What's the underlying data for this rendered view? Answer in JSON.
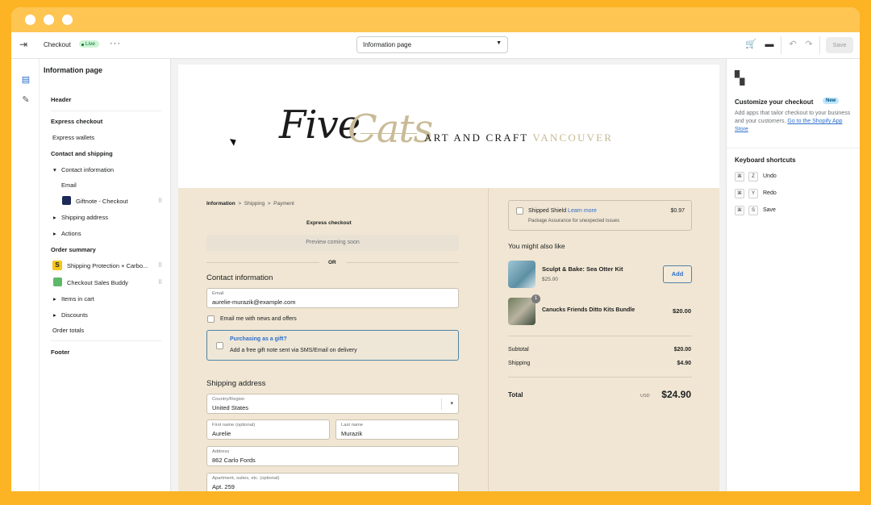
{
  "topbar": {
    "title": "Checkout",
    "badge": "Live",
    "more": "···",
    "page_select": "Information page",
    "save": "Save"
  },
  "sidebar": {
    "title": "Information page",
    "header": "Header",
    "express_checkout": "Express checkout",
    "express_wallets": "Express wallets",
    "contact_shipping": "Contact and shipping",
    "contact_information": "Contact information",
    "email": "Email",
    "giftnote": "Giftnote - Checkout",
    "shipping_address": "Shipping address",
    "actions": "Actions",
    "order_summary": "Order summary",
    "shipping_protection": "Shipping Protection + Carbo...",
    "checkout_sales_buddy": "Checkout Sales Buddy",
    "items_in_cart": "Items in cart",
    "discounts": "Discounts",
    "order_totals": "Order totals",
    "footer": "Footer"
  },
  "logo": {
    "five": "Five",
    "cats": "Cats",
    "sub1": "ART AND CRAFT",
    "sub2": "VANCOUVER"
  },
  "checkout": {
    "crumb_information": "Information",
    "crumb_shipping": "Shipping",
    "crumb_payment": "Payment",
    "express_checkout": "Express checkout",
    "preview": "Preview coming soon",
    "or": "OR",
    "contact_title": "Contact information",
    "email_label": "Email",
    "email_value": "aurelie-murazik@example.com",
    "news_label": "Email me with news and offers",
    "gift_title": "Purchasing as a gift?",
    "gift_sub": "Add a free gift note sent via SMS/Email on delivery",
    "shipping_title": "Shipping address",
    "country_label": "Country/Region",
    "country_value": "United States",
    "first_label": "First name (optional)",
    "first_value": "Aurelie",
    "last_label": "Last name",
    "last_value": "Murazik",
    "address_label": "Address",
    "address_value": "862 Carlo Fords",
    "apt_label": "Apartment, suites, etc. (optional)",
    "apt_value": "Apt. 259"
  },
  "summary": {
    "shield_title": "Shipped Shield",
    "shield_link": "Learn more",
    "shield_sub": "Package Assurance for unexpected issues",
    "shield_price": "$0.97",
    "also_like": "You might also like",
    "rec_name": "Sculpt & Bake: Sea Otter Kit",
    "rec_price": "$25.00",
    "add": "Add",
    "item_qty": "1",
    "item_name": "Canucks Friends Ditto Kits Bundle",
    "item_price": "$20.00",
    "subtotal_label": "Subtotal",
    "subtotal_value": "$20.00",
    "shipping_label": "Shipping",
    "shipping_value": "$4.90",
    "total_label": "Total",
    "currency": "USD",
    "total_value": "$24.90"
  },
  "right_panel": {
    "title": "Customize your checkout",
    "badge": "New",
    "text": "Add apps that tailor checkout to your business and your customers.",
    "link": "Go to the Shopify App Store",
    "shortcuts_title": "Keyboard shortcuts",
    "undo": "Undo",
    "redo": "Redo",
    "save": "Save",
    "key_mod": "⌘",
    "key_z": "Z",
    "key_y": "Y",
    "key_s": "S"
  },
  "colors": {
    "frame": "#fcb424",
    "checkout_bg": "#f0e6d3",
    "accent": "#2c6ecb",
    "logo_gold": "#c9bb97"
  }
}
